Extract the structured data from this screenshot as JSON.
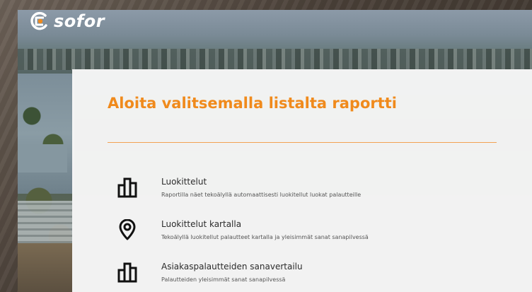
{
  "brand": {
    "name": "sofor",
    "accent_color": "#f08a1c",
    "logo_icon": "sofor-logo-icon"
  },
  "panel": {
    "title": "Aloita valitsemalla listalta raportti",
    "divider_color": "#f3a253"
  },
  "reports": [
    {
      "icon": "bar-chart-icon",
      "name": "Luokittelut",
      "description": "Raportilla näet tekoälyllä automaattisesti luokitellut luokat palautteille"
    },
    {
      "icon": "map-pin-icon",
      "name": "Luokittelut kartalla",
      "description": "Tekoälyllä luokitellut palautteet kartalla ja yleisimmät sanat sanapilvessä"
    },
    {
      "icon": "bar-chart-icon",
      "name": "Asiakaspalautteiden sanavertailu",
      "description": "Palautteiden yleisimmät sanat sanapilvessä"
    }
  ]
}
